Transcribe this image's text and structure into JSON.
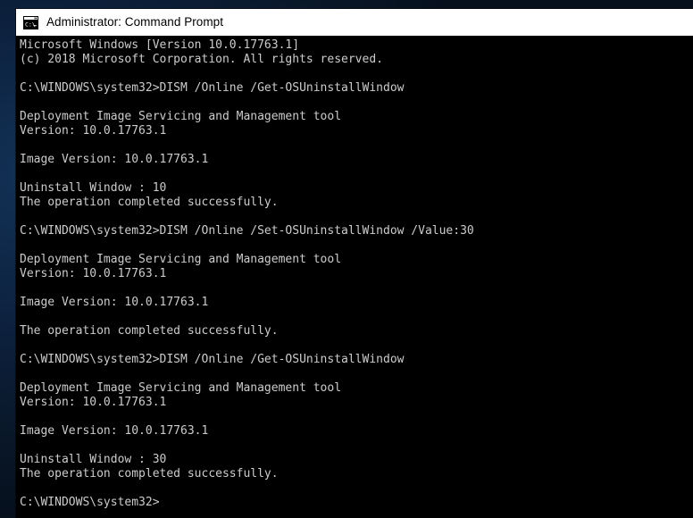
{
  "window": {
    "title": "Administrator: Command Prompt",
    "icon": "console-window-icon",
    "icon_glyph": "C:\\",
    "background_color": "#000000",
    "titlebar_color": "#ffffff",
    "text_color": "#cccccc"
  },
  "desktop": {
    "background_color": "#0c2342"
  },
  "terminal": {
    "lines": [
      "Microsoft Windows [Version 10.0.17763.1]",
      "(c) 2018 Microsoft Corporation. All rights reserved.",
      "",
      "C:\\WINDOWS\\system32>DISM /Online /Get-OSUninstallWindow",
      "",
      "Deployment Image Servicing and Management tool",
      "Version: 10.0.17763.1",
      "",
      "Image Version: 10.0.17763.1",
      "",
      "Uninstall Window : 10",
      "The operation completed successfully.",
      "",
      "C:\\WINDOWS\\system32>DISM /Online /Set-OSUninstallWindow /Value:30",
      "",
      "Deployment Image Servicing and Management tool",
      "Version: 10.0.17763.1",
      "",
      "Image Version: 10.0.17763.1",
      "",
      "The operation completed successfully.",
      "",
      "C:\\WINDOWS\\system32>DISM /Online /Get-OSUninstallWindow",
      "",
      "Deployment Image Servicing and Management tool",
      "Version: 10.0.17763.1",
      "",
      "Image Version: 10.0.17763.1",
      "",
      "Uninstall Window : 30",
      "The operation completed successfully.",
      "",
      "C:\\WINDOWS\\system32>"
    ]
  }
}
